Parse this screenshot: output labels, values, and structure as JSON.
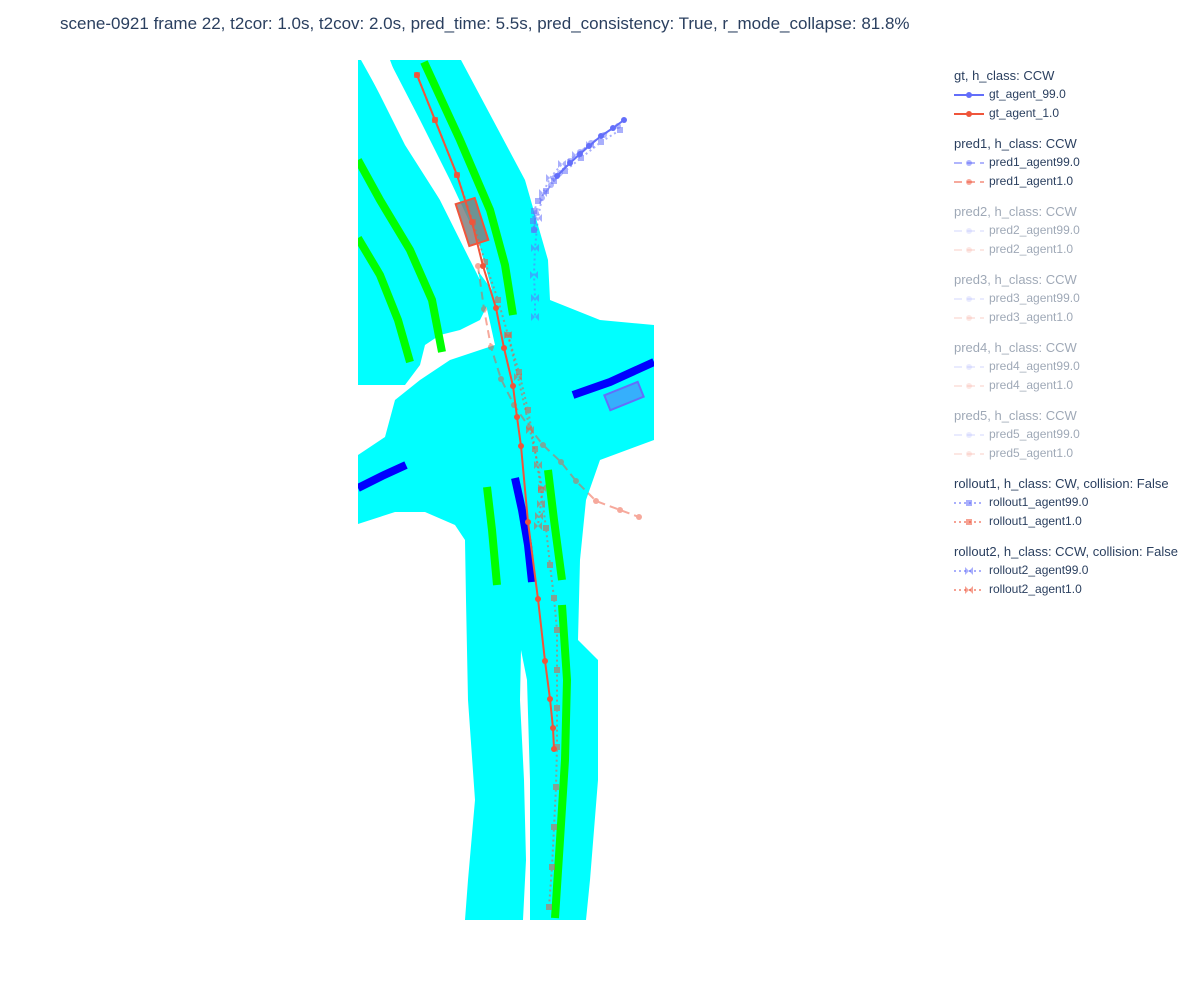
{
  "title": "scene-0921 frame 22, t2cor: 1.0s, t2cov: 2.0s, pred_time: 5.5s, pred_consistency: True, r_mode_collapse: 81.8%",
  "colors": {
    "drivable": "#00ffff",
    "lane_green": "#00ff00",
    "lane_blue": "#0000ff",
    "agent99": "#636efa",
    "agent1": "#ef553b"
  },
  "legend": [
    {
      "title": "gt, h_class: CCW",
      "active": true,
      "items": [
        {
          "label": "gt_agent_99.0",
          "color": "#636efa",
          "dash": "solid",
          "marker": "circle",
          "opacity": 1.0
        },
        {
          "label": "gt_agent_1.0",
          "color": "#ef553b",
          "dash": "solid",
          "marker": "circle",
          "opacity": 1.0
        }
      ]
    },
    {
      "title": "pred1, h_class: CCW",
      "active": true,
      "items": [
        {
          "label": "pred1_agent99.0",
          "color": "#636efa",
          "dash": "dash",
          "marker": "circle",
          "opacity": 0.5
        },
        {
          "label": "pred1_agent1.0",
          "color": "#ef553b",
          "dash": "dash",
          "marker": "circle",
          "opacity": 0.5
        }
      ]
    },
    {
      "title": "pred2, h_class: CCW",
      "active": false,
      "items": [
        {
          "label": "pred2_agent99.0",
          "color": "#636efa",
          "dash": "dash",
          "marker": "circle",
          "opacity": 0.3
        },
        {
          "label": "pred2_agent1.0",
          "color": "#ef553b",
          "dash": "dash",
          "marker": "circle",
          "opacity": 0.3
        }
      ]
    },
    {
      "title": "pred3, h_class: CCW",
      "active": false,
      "items": [
        {
          "label": "pred3_agent99.0",
          "color": "#636efa",
          "dash": "dash",
          "marker": "circle",
          "opacity": 0.3
        },
        {
          "label": "pred3_agent1.0",
          "color": "#ef553b",
          "dash": "dash",
          "marker": "circle",
          "opacity": 0.3
        }
      ]
    },
    {
      "title": "pred4, h_class: CCW",
      "active": false,
      "items": [
        {
          "label": "pred4_agent99.0",
          "color": "#636efa",
          "dash": "dash",
          "marker": "circle",
          "opacity": 0.3
        },
        {
          "label": "pred4_agent1.0",
          "color": "#ef553b",
          "dash": "dash",
          "marker": "circle",
          "opacity": 0.3
        }
      ]
    },
    {
      "title": "pred5, h_class: CCW",
      "active": false,
      "items": [
        {
          "label": "pred5_agent99.0",
          "color": "#636efa",
          "dash": "dash",
          "marker": "circle",
          "opacity": 0.3
        },
        {
          "label": "pred5_agent1.0",
          "color": "#ef553b",
          "dash": "dash",
          "marker": "circle",
          "opacity": 0.3
        }
      ]
    },
    {
      "title": "rollout1, h_class: CW, collision: False",
      "active": true,
      "items": [
        {
          "label": "rollout1_agent99.0",
          "color": "#636efa",
          "dash": "dot",
          "marker": "square",
          "opacity": 0.55
        },
        {
          "label": "rollout1_agent1.0",
          "color": "#ef553b",
          "dash": "dot",
          "marker": "square",
          "opacity": 0.55
        }
      ]
    },
    {
      "title": "rollout2, h_class: CCW, collision: False",
      "active": true,
      "items": [
        {
          "label": "rollout2_agent99.0",
          "color": "#636efa",
          "dash": "dot",
          "marker": "bowtie",
          "opacity": 0.55
        },
        {
          "label": "rollout2_agent1.0",
          "color": "#ef553b",
          "dash": "dot",
          "marker": "bowtie",
          "opacity": 0.55
        }
      ]
    }
  ],
  "chart_data": {
    "type": "scatter",
    "title": "scene-0921 frame 22, t2cor: 1.0s, t2cov: 2.0s, pred_time: 5.5s, pred_consistency: True, r_mode_collapse: 81.8%",
    "xlabel": "",
    "ylabel": "",
    "xlim": [
      0,
      296
    ],
    "ylim": [
      0,
      860
    ],
    "grid": false,
    "legend_position": "right",
    "series": [
      {
        "name": "gt_agent_99.0",
        "dash": "solid",
        "marker": "circle",
        "opacity": 1.0,
        "color": "#636efa",
        "x": [
          266,
          255,
          243,
          231,
          222,
          212,
          199
        ],
        "y": [
          800,
          792,
          784,
          774,
          766,
          757,
          744
        ]
      },
      {
        "name": "gt_agent_1.0",
        "dash": "solid",
        "marker": "circle",
        "opacity": 1.0,
        "color": "#ef553b",
        "x": [
          59,
          77,
          99,
          114,
          125,
          138,
          146,
          155,
          159,
          163,
          170,
          180,
          187,
          192,
          195,
          196
        ],
        "y": [
          845,
          800,
          745,
          698,
          654,
          612,
          572,
          534,
          503,
          474,
          398,
          321,
          259,
          221,
          192,
          171
        ]
      },
      {
        "name": "pred1_agent99.0",
        "dash": "dash",
        "marker": "circle",
        "opacity": 0.5,
        "color": "#636efa",
        "x": [
          260,
          246,
          233,
          222,
          212,
          202,
          193,
          184,
          178,
          176
        ],
        "y": [
          794,
          785,
          777,
          768,
          759,
          747,
          735,
          722,
          707,
          690
        ]
      },
      {
        "name": "pred1_agent1.0",
        "dash": "dash",
        "marker": "circle",
        "opacity": 0.5,
        "color": "#ef553b",
        "x": [
          120,
          126,
          133,
          143,
          156,
          171,
          185,
          203,
          218,
          238,
          262,
          281
        ],
        "y": [
          654,
          611,
          573,
          541,
          515,
          493,
          475,
          458,
          439,
          419,
          410,
          403
        ]
      },
      {
        "name": "rollout1_agent99.0",
        "dash": "dot",
        "marker": "square",
        "opacity": 0.55,
        "color": "#636efa",
        "x": [
          262,
          243,
          223,
          207,
          196,
          188,
          180,
          176,
          175,
          176
        ],
        "y": [
          790,
          778,
          762,
          749,
          739,
          729,
          719,
          709,
          699,
          690
        ]
      },
      {
        "name": "rollout1_agent1.0",
        "dash": "dot",
        "marker": "square",
        "opacity": 0.55,
        "color": "#ef553b",
        "x": [
          59,
          77,
          99,
          115,
          127,
          140,
          150,
          161,
          170,
          177,
          183,
          188,
          192,
          196,
          199,
          199,
          199,
          199,
          198,
          196,
          194,
          191
        ],
        "y": [
          845,
          800,
          745,
          698,
          658,
          620,
          585,
          548,
          510,
          471,
          430,
          392,
          355,
          322,
          290,
          250,
          212,
          173,
          133,
          93,
          53,
          13
        ]
      },
      {
        "name": "rollout2_agent99.0",
        "dash": "dot",
        "marker": "bowtie",
        "opacity": 0.55,
        "color": "#636efa",
        "x": [
          232,
          218,
          204,
          192,
          185,
          180,
          177,
          176,
          177,
          177
        ],
        "y": [
          775,
          765,
          756,
          742,
          727,
          702,
          672,
          645,
          622,
          603
        ]
      },
      {
        "name": "rollout2_agent1.0",
        "dash": "dot",
        "marker": "bowtie",
        "opacity": 0.55,
        "color": "#ef553b",
        "x": [
          150,
          160,
          172,
          180,
          184,
          183,
          181,
          180
        ],
        "y": [
          585,
          543,
          490,
          455,
          432,
          416,
          404,
          394
        ]
      }
    ]
  }
}
